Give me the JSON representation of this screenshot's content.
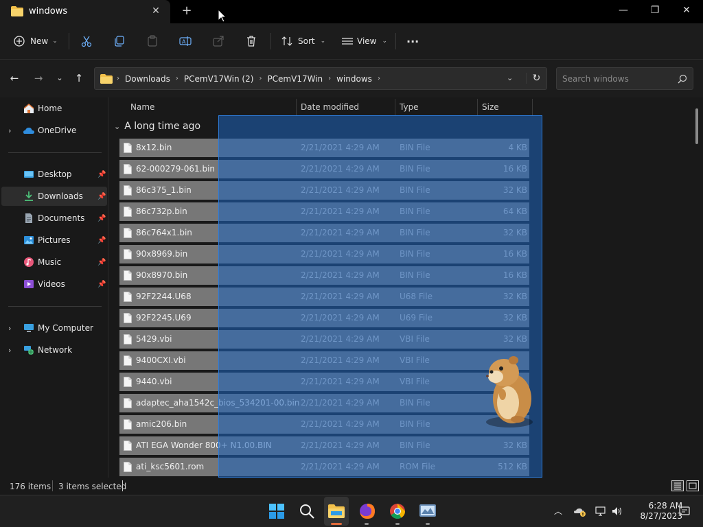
{
  "window": {
    "tab_title": "windows",
    "new_tab_label": "+",
    "close_tab_label": "✕",
    "minimize_label": "—",
    "maximize_label": "❐",
    "close_label": "✕"
  },
  "toolbar": {
    "new_label": "New",
    "sort_label": "Sort",
    "view_label": "View",
    "more_label": "···"
  },
  "address": {
    "crumbs": [
      "Downloads",
      "PCemV17Win (2)",
      "PCemV17Win",
      "windows"
    ],
    "search_placeholder": "Search windows"
  },
  "sidebar": {
    "items": [
      {
        "label": "Home",
        "icon": "home-icon"
      },
      {
        "label": "OneDrive",
        "icon": "onedrive-icon"
      },
      {
        "label": "Desktop",
        "icon": "desktop-icon"
      },
      {
        "label": "Downloads",
        "icon": "downloads-icon"
      },
      {
        "label": "Documents",
        "icon": "documents-icon"
      },
      {
        "label": "Pictures",
        "icon": "pictures-icon"
      },
      {
        "label": "Music",
        "icon": "music-icon"
      },
      {
        "label": "Videos",
        "icon": "videos-icon"
      },
      {
        "label": "My Computer",
        "icon": "computer-icon"
      },
      {
        "label": "Network",
        "icon": "network-icon"
      }
    ]
  },
  "columns": {
    "name": "Name",
    "date": "Date modified",
    "type": "Type",
    "size": "Size"
  },
  "group": {
    "title": "A long time ago"
  },
  "files": [
    {
      "name": "8x12.bin",
      "date": "2/21/2021 4:29 AM",
      "type": "BIN File",
      "size": "4 KB"
    },
    {
      "name": "62-000279-061.bin",
      "date": "2/21/2021 4:29 AM",
      "type": "BIN File",
      "size": "16 KB"
    },
    {
      "name": "86c375_1.bin",
      "date": "2/21/2021 4:29 AM",
      "type": "BIN File",
      "size": "32 KB"
    },
    {
      "name": "86c732p.bin",
      "date": "2/21/2021 4:29 AM",
      "type": "BIN File",
      "size": "64 KB"
    },
    {
      "name": "86c764x1.bin",
      "date": "2/21/2021 4:29 AM",
      "type": "BIN File",
      "size": "32 KB"
    },
    {
      "name": "90x8969.bin",
      "date": "2/21/2021 4:29 AM",
      "type": "BIN File",
      "size": "16 KB"
    },
    {
      "name": "90x8970.bin",
      "date": "2/21/2021 4:29 AM",
      "type": "BIN File",
      "size": "16 KB"
    },
    {
      "name": "92F2244.U68",
      "date": "2/21/2021 4:29 AM",
      "type": "U68 File",
      "size": "32 KB"
    },
    {
      "name": "92F2245.U69",
      "date": "2/21/2021 4:29 AM",
      "type": "U69 File",
      "size": "32 KB"
    },
    {
      "name": "5429.vbi",
      "date": "2/21/2021 4:29 AM",
      "type": "VBI File",
      "size": "32 KB"
    },
    {
      "name": "9400CXI.vbi",
      "date": "2/21/2021 4:29 AM",
      "type": "VBI File",
      "size": ""
    },
    {
      "name": "9440.vbi",
      "date": "2/21/2021 4:29 AM",
      "type": "VBI File",
      "size": ""
    },
    {
      "name": "adaptec_aha1542c_bios_534201-00.bin",
      "date": "2/21/2021 4:29 AM",
      "type": "BIN File",
      "size": ""
    },
    {
      "name": "amic206.bin",
      "date": "2/21/2021 4:29 AM",
      "type": "BIN File",
      "size": ""
    },
    {
      "name": "ATI EGA Wonder 800+ N1.00.BIN",
      "date": "2/21/2021 4:29 AM",
      "type": "BIN File",
      "size": "32 KB"
    },
    {
      "name": "ati_ksc5601.rom",
      "date": "2/21/2021 4:29 AM",
      "type": "ROM File",
      "size": "512 KB"
    }
  ],
  "status": {
    "item_count": "176 items",
    "selected_count": "3 items selected"
  },
  "clock": {
    "time": "6:28 AM",
    "date": "8/27/2023"
  },
  "colors": {
    "accent": "#2d7ad6",
    "folder": "#f2c04a"
  }
}
